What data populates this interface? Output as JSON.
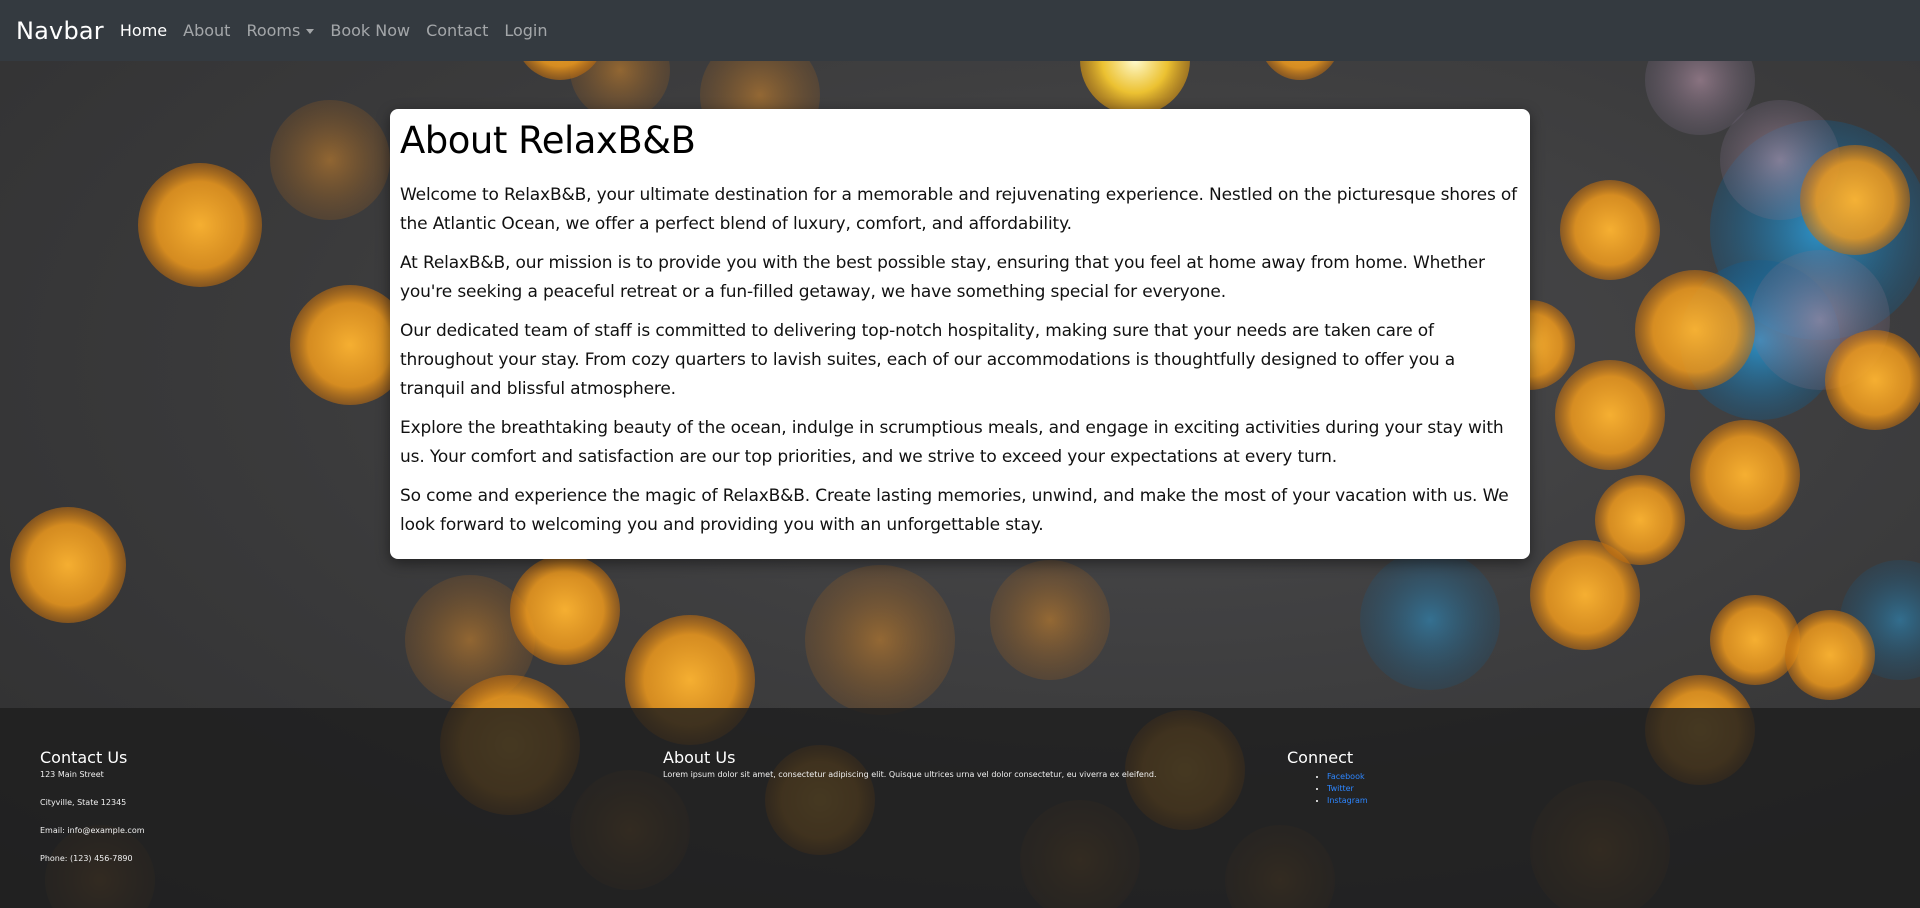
{
  "navbar": {
    "brand": "Navbar",
    "items": [
      {
        "label": "Home",
        "active": true
      },
      {
        "label": "About",
        "active": false
      },
      {
        "label": "Rooms",
        "active": false,
        "dropdown": true
      },
      {
        "label": "Book Now",
        "active": false
      },
      {
        "label": "Contact",
        "active": false
      },
      {
        "label": "Login",
        "active": false
      }
    ]
  },
  "about": {
    "title": "About RelaxB&B",
    "paragraphs": [
      "Welcome to RelaxB&B, your ultimate destination for a memorable and rejuvenating experience. Nestled on the picturesque shores of the Atlantic Ocean, we offer a perfect blend of luxury, comfort, and affordability.",
      "At RelaxB&B, our mission is to provide you with the best possible stay, ensuring that you feel at home away from home. Whether you're seeking a peaceful retreat or a fun-filled getaway, we have something special for everyone.",
      "Our dedicated team of staff is committed to delivering top-notch hospitality, making sure that your needs are taken care of throughout your stay. From cozy quarters to lavish suites, each of our accommodations is thoughtfully designed to offer you a tranquil and blissful atmosphere.",
      "Explore the breathtaking beauty of the ocean, indulge in scrumptious meals, and engage in exciting activities during your stay with us. Your comfort and satisfaction are our top priorities, and we strive to exceed your expectations at every turn.",
      "So come and experience the magic of RelaxB&B. Create lasting memories, unwind, and make the most of your vacation with us. We look forward to welcoming you and providing you with an unforgettable stay."
    ]
  },
  "footer": {
    "contact": {
      "heading": "Contact Us",
      "address": "123 Main Street",
      "city": "Cityville, State 12345",
      "email": "Email: info@example.com",
      "phone": "Phone: (123) 456-7890"
    },
    "about": {
      "heading": "About Us",
      "text": "Lorem ipsum dolor sit amet, consectetur adipiscing elit. Quisque ultrices urna vel dolor consectetur, eu viverra ex eleifend."
    },
    "connect": {
      "heading": "Connect",
      "links": [
        "Facebook",
        "Twitter",
        "Instagram"
      ]
    }
  },
  "colors": {
    "navbar_bg": "#343a40",
    "link_blue": "#2d86ff",
    "bokeh_orange": "#f0a020",
    "bokeh_blue": "#1a8fd0"
  }
}
